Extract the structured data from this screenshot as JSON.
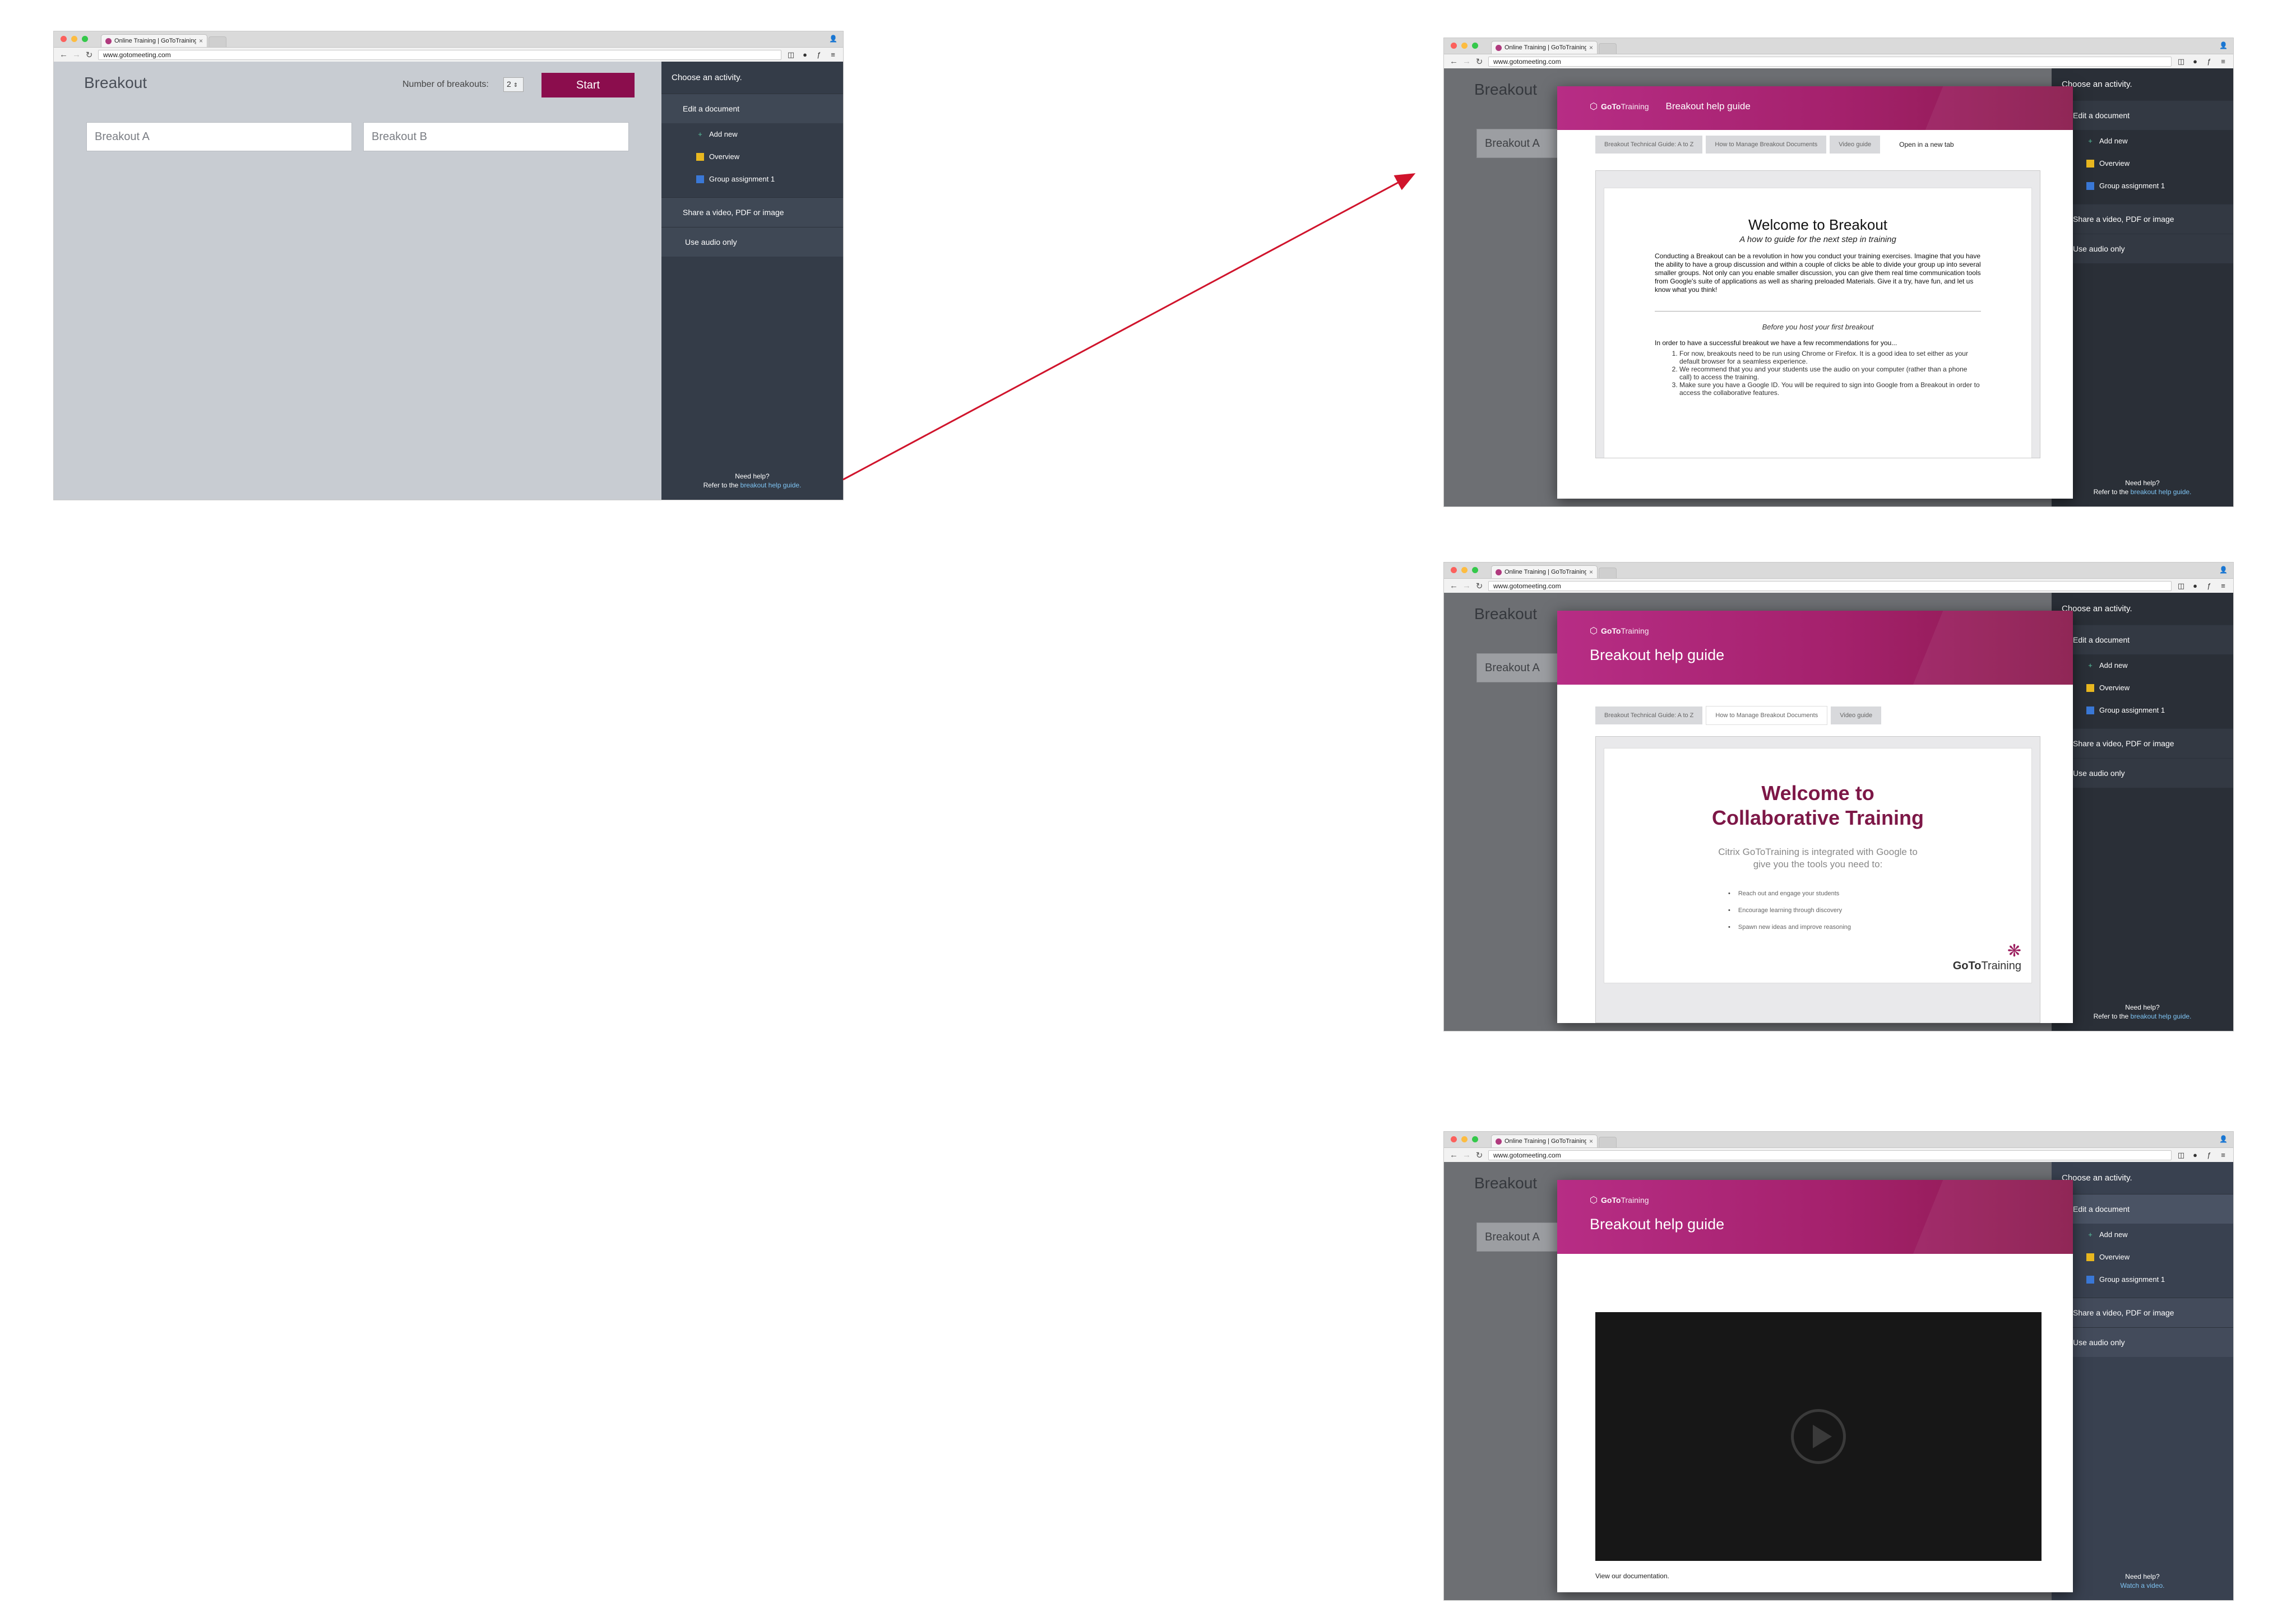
{
  "browser": {
    "tab_title": "Online Training | GoToTraining",
    "url": "www.gotomeeting.com",
    "traffic_lights": [
      "#fc605c",
      "#fdbc40",
      "#34c84a"
    ]
  },
  "app": {
    "title": "Breakout",
    "breakouts_label": "Number of breakouts:",
    "breakouts_value": "2",
    "start_label": "Start",
    "breakout_a": "Breakout A",
    "breakout_b": "Breakout B"
  },
  "sidebar": {
    "heading": "Choose an activity.",
    "edit_document": "Edit a document",
    "add_new": "Add new",
    "overview": "Overview",
    "group_assignment": "Group assignment 1",
    "share_media": "Share a video, PDF or image",
    "audio_only": "Use audio only",
    "need_help": "Need help?",
    "refer_prefix": "Refer to the",
    "help_link": "breakout help guide.",
    "watch_video": "Watch a video."
  },
  "guide": {
    "brand_goto": "GoTo",
    "brand_training": "Training",
    "title": "Breakout help guide",
    "tabs": [
      "Breakout Technical Guide: A to Z",
      "How to Manage Breakout Documents",
      "Video guide"
    ],
    "open_new_tab": "Open in a new tab"
  },
  "doc1": {
    "title": "Welcome to Breakout",
    "subtitle": "A how to guide for the next step in training",
    "intro": "Conducting a Breakout can be a revolution in how you conduct your training exercises. Imagine that you have the ability to have a group discussion and within a couple of clicks be able to divide your group up into several smaller groups.  Not only can you enable smaller discussion, you can give them real time communication tools from Google's suite of applications as well as sharing preloaded Materials. Give it a try, have fun, and let us know what you think!",
    "section_title": "Before you host your first breakout",
    "section_intro": "In order to have a successful breakout we have a few recommendations for you...",
    "items": [
      "For now, breakouts need to be run using Chrome or Firefox. It is a good idea to set either as your default browser for a seamless experience.",
      "We recommend that you and your students use the audio on your computer (rather than a phone call) to access the training.",
      "Make sure you have a Google ID. You will be required to sign into Google from a Breakout in order to access the collaborative features."
    ]
  },
  "doc2": {
    "title_line1": "Welcome to",
    "title_line2": "Collaborative Training",
    "intro": "Citrix GoToTraining is integrated with Google to give you the tools you need to:",
    "bullets": [
      "Reach out and engage your students",
      "Encourage learning through discovery",
      "Spawn new ideas and improve reasoning"
    ],
    "logo_goto": "GoTo",
    "logo_training": "Training"
  },
  "video": {
    "view_docs": "View our documentation."
  },
  "colors": {
    "accent": "#8b0d4d",
    "sidebar": "#343c48",
    "arrow": "#d0142c"
  }
}
